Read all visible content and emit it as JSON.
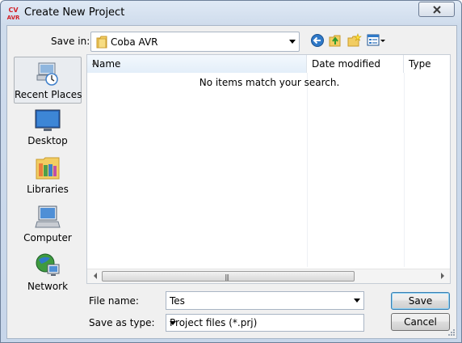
{
  "window": {
    "title": "Create New Project",
    "app_icon_text_top": "CV",
    "app_icon_text_bottom": "AVR"
  },
  "toolbar": {
    "save_in_label": "Save in:",
    "location_value": "Coba AVR"
  },
  "places": [
    {
      "label": "Recent Places",
      "icon": "recent-places-icon",
      "selected": true
    },
    {
      "label": "Desktop",
      "icon": "desktop-icon",
      "selected": false
    },
    {
      "label": "Libraries",
      "icon": "libraries-icon",
      "selected": false
    },
    {
      "label": "Computer",
      "icon": "computer-icon",
      "selected": false
    },
    {
      "label": "Network",
      "icon": "network-icon",
      "selected": false
    }
  ],
  "filelist": {
    "columns": [
      "Name",
      "Date modified",
      "Type"
    ],
    "sorted_column": "Name",
    "empty_message": "No items match your search."
  },
  "form": {
    "file_name_label": "File name:",
    "file_name_value": "Tes",
    "save_as_type_label": "Save as type:",
    "save_as_type_value": "Project files (*.prj)"
  },
  "buttons": {
    "save": "Save",
    "cancel": "Cancel"
  },
  "colors": {
    "title_gradient": "#dfe9f5",
    "client_bg": "#f0f0f0",
    "default_button_border": "#3c7fb1",
    "app_icon_red": "#d21f26"
  }
}
